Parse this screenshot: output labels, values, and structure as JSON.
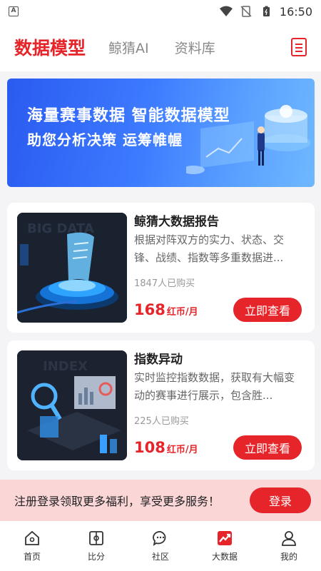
{
  "status_bar": {
    "app_badge": "A",
    "time": "16:50"
  },
  "top_nav": {
    "tabs": [
      {
        "label": "数据模型",
        "active": true
      },
      {
        "label": "鲸猜AI",
        "active": false
      },
      {
        "label": "资料库",
        "active": false
      }
    ],
    "right_icon": "document-list-icon"
  },
  "banner": {
    "line1": "海量赛事数据 智能数据模型",
    "line2": "助您分析决策 运筹帷幄"
  },
  "cards": [
    {
      "title": "鲸猜大数据报告",
      "desc": "根据对阵双方的实力、状态、交锋、战绩、指数等多重数据进...",
      "buyers": "1847人已购买",
      "price": "168",
      "unit": "红币/月",
      "button": "立即查看",
      "thumb_watermark": "BIG DATA"
    },
    {
      "title": "指数异动",
      "desc": "实时监控指数数据，获取有大幅变动的赛事进行展示，包含胜...",
      "buyers": "225人已购买",
      "price": "108",
      "unit": "红币/月",
      "button": "立即查看",
      "thumb_watermark": "INDEX"
    }
  ],
  "register_bar": {
    "text": "注册登录领取更多福利，享受更多服务！",
    "button": "登录"
  },
  "bottom_nav": [
    {
      "label": "首页",
      "icon": "home-icon",
      "active": false
    },
    {
      "label": "比分",
      "icon": "score-icon",
      "active": false
    },
    {
      "label": "社区",
      "icon": "chat-icon",
      "active": false
    },
    {
      "label": "大数据",
      "icon": "big-data-icon",
      "active": true
    },
    {
      "label": "我的",
      "icon": "profile-icon",
      "active": false
    }
  ],
  "colors": {
    "accent": "#e5252a",
    "banner": "#3d7bff",
    "register_bg": "#fbd6d7"
  }
}
